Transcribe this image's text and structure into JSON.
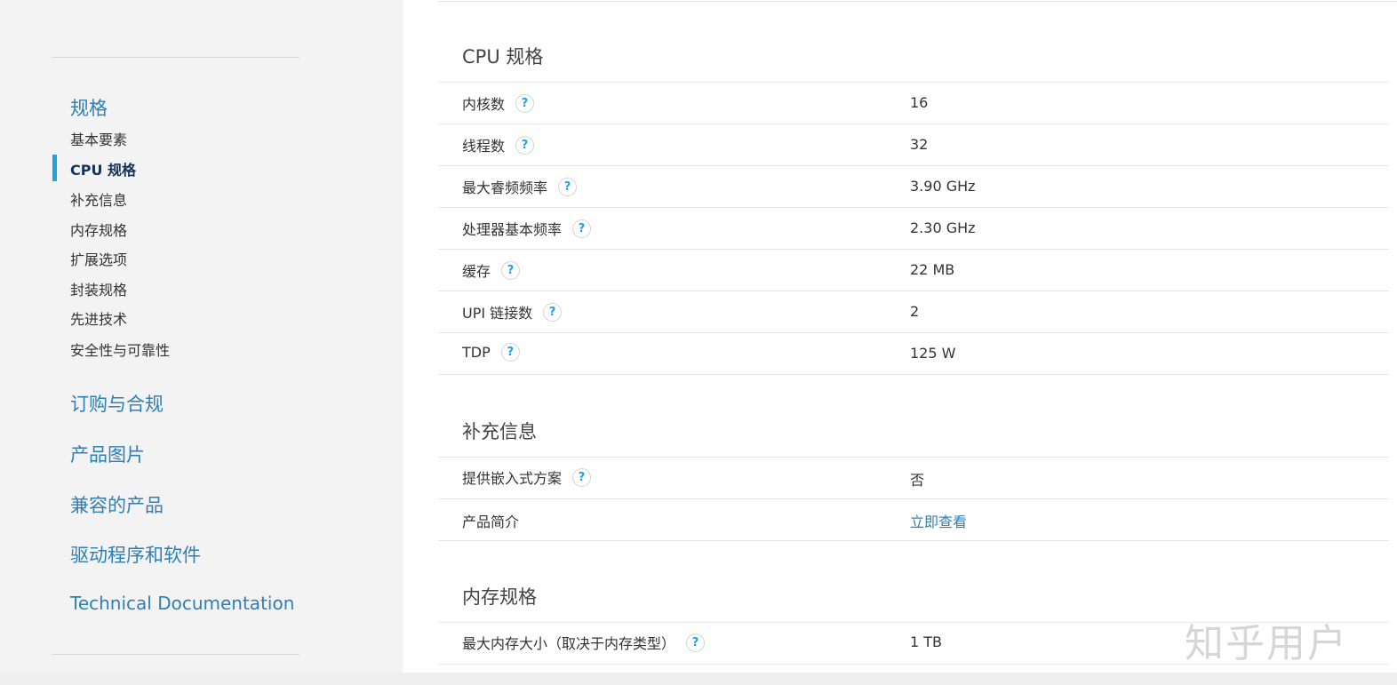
{
  "sidebar": {
    "headings": {
      "spec": "规格",
      "ordering": "订购与合规",
      "images": "产品图片",
      "compatible": "兼容的产品",
      "drivers": "驱动程序和软件",
      "docs": "Technical Documentation"
    },
    "items": [
      {
        "label": "基本要素"
      },
      {
        "label": "CPU 规格"
      },
      {
        "label": "补充信息"
      },
      {
        "label": "内存规格"
      },
      {
        "label": "扩展选项"
      },
      {
        "label": "封装规格"
      },
      {
        "label": "先进技术"
      },
      {
        "label": "安全性与可靠性"
      }
    ],
    "active_item": "CPU 规格"
  },
  "sections": {
    "cpu": {
      "title": "CPU 规格",
      "rows": [
        {
          "label": "内核数",
          "value": "16"
        },
        {
          "label": "线程数",
          "value": "32"
        },
        {
          "label": "最大睿频频率",
          "value": "3.90 GHz"
        },
        {
          "label": "处理器基本频率",
          "value": "2.30 GHz"
        },
        {
          "label": "缓存",
          "value": "22 MB"
        },
        {
          "label": "UPI 链接数",
          "value": "2"
        },
        {
          "label": "TDP",
          "value": "125 W"
        }
      ]
    },
    "supplemental": {
      "title": "补充信息",
      "rows": [
        {
          "label": "提供嵌入式方案",
          "value": "否"
        },
        {
          "label": "产品简介",
          "value": "立即查看"
        }
      ]
    },
    "memory": {
      "title": "内存规格",
      "rows": [
        {
          "label": "最大内存大小（取决于内存类型）",
          "value": "1 TB"
        }
      ]
    }
  },
  "help_glyph": "?",
  "watermark": "知乎用户",
  "colors": {
    "accent": "#1aa4e0",
    "link": "#2f7fb7",
    "active_text": "#15335a",
    "sidebar_bg": "#f3f3f3"
  }
}
